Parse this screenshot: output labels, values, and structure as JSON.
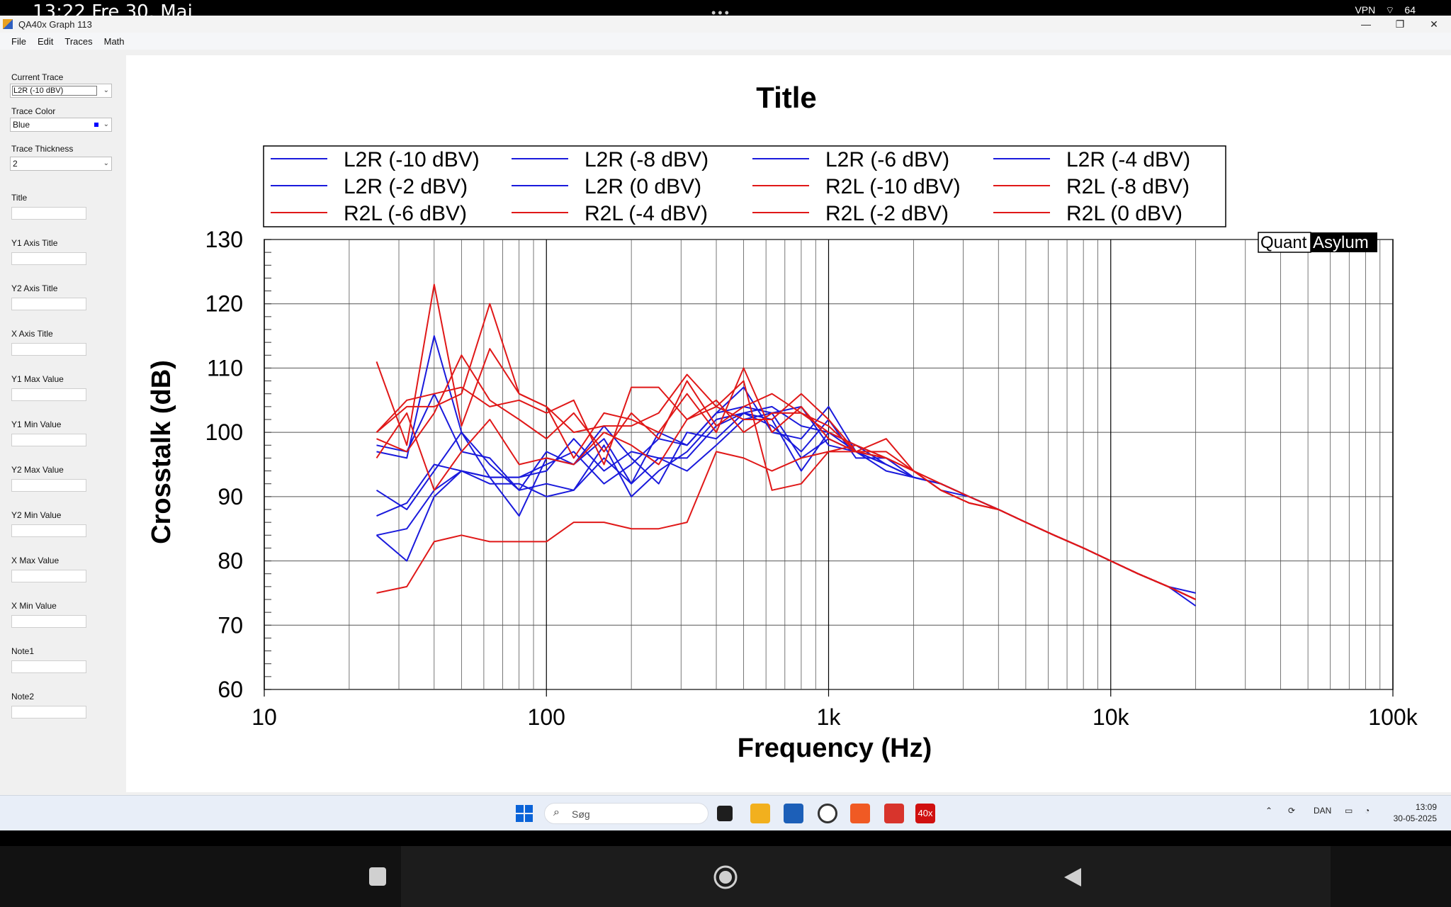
{
  "android": {
    "status_time": "13:22  Fre 30. Maj",
    "status_icons": [
      "VPN",
      "wifi",
      "battery"
    ],
    "battery": "64"
  },
  "window": {
    "title": "QA40x Graph 113",
    "controls": {
      "minimize": "—",
      "maximize": "❐",
      "close": "✕"
    }
  },
  "menu": [
    "File",
    "Edit",
    "Traces",
    "Math"
  ],
  "panel": {
    "current_trace_label": "Current Trace",
    "current_trace_value": "L2R (-10 dBV)",
    "trace_color_label": "Trace Color",
    "trace_color_value": "Blue",
    "trace_thickness_label": "Trace Thickness",
    "trace_thickness_value": "2",
    "fields": [
      {
        "label": "Title",
        "value": ""
      },
      {
        "label": "Y1 Axis Title",
        "value": ""
      },
      {
        "label": "Y2 Axis Title",
        "value": ""
      },
      {
        "label": "X Axis Title",
        "value": ""
      },
      {
        "label": "Y1 Max Value",
        "value": ""
      },
      {
        "label": "Y1 Min Value",
        "value": ""
      },
      {
        "label": "Y2 Max Value",
        "value": ""
      },
      {
        "label": "Y2 Min Value",
        "value": ""
      },
      {
        "label": "X Max Value",
        "value": ""
      },
      {
        "label": "X Min Value",
        "value": ""
      },
      {
        "label": "Note1",
        "value": ""
      },
      {
        "label": "Note2",
        "value": ""
      }
    ]
  },
  "chart_data": {
    "type": "line",
    "title": "Title",
    "xlabel": "Frequency (Hz)",
    "ylabel": "Crosstalk (dB)",
    "x_scale": "log",
    "xlim": [
      10,
      100000
    ],
    "ylim": [
      60,
      130
    ],
    "x_ticks": [
      {
        "value": 10,
        "label": "10"
      },
      {
        "value": 100,
        "label": "100"
      },
      {
        "value": 1000,
        "label": "1k"
      },
      {
        "value": 10000,
        "label": "10k"
      },
      {
        "value": 100000,
        "label": "100k"
      }
    ],
    "y_ticks": [
      130,
      120,
      110,
      100,
      90,
      80,
      70,
      60
    ],
    "grid": true,
    "legend_position": "top",
    "watermark": {
      "part1": "Quant",
      "part2": "Asylum"
    },
    "colors": {
      "L2R": "#1a1adc",
      "R2L": "#e01818"
    },
    "x": [
      25,
      32,
      40,
      50,
      63,
      80,
      100,
      125,
      160,
      200,
      250,
      315,
      400,
      500,
      630,
      800,
      1000,
      1250,
      1600,
      2000,
      2500,
      3150,
      4000,
      5000,
      6300,
      8000,
      10000,
      12500,
      16000,
      20000
    ],
    "series": [
      {
        "name": "L2R (-10 dBV)",
        "group": "L2R",
        "values": [
          91,
          88,
          94,
          100,
          93,
          93,
          95,
          97,
          92,
          95,
          99,
          98,
          103,
          107,
          100,
          99,
          104,
          97,
          94,
          93,
          92,
          90,
          88,
          86,
          84,
          82,
          80,
          78,
          76,
          75
        ]
      },
      {
        "name": "L2R (-8 dBV)",
        "group": "L2R",
        "values": [
          87,
          89,
          95,
          94,
          93,
          87,
          96,
          95,
          101,
          96,
          92,
          100,
          99,
          103,
          101,
          97,
          102,
          96,
          96,
          94,
          91,
          90,
          88,
          86,
          84,
          82,
          80,
          78,
          76,
          74
        ]
      },
      {
        "name": "L2R (-6 dBV)",
        "group": "L2R",
        "values": [
          97,
          96,
          115,
          100,
          95,
          91,
          92,
          91,
          98,
          90,
          94,
          97,
          102,
          103,
          104,
          101,
          100,
          98,
          95,
          93,
          92,
          90,
          88,
          86,
          84,
          82,
          80,
          78,
          76,
          74
        ]
      },
      {
        "name": "L2R (-4 dBV)",
        "group": "L2R",
        "values": [
          84,
          85,
          91,
          94,
          93,
          93,
          94,
          99,
          94,
          97,
          96,
          96,
          101,
          103,
          102,
          94,
          100,
          97,
          96,
          93,
          92,
          90,
          88,
          86,
          84,
          82,
          80,
          78,
          76,
          74
        ]
      },
      {
        "name": "L2R (-2 dBV)",
        "group": "L2R",
        "values": [
          84,
          80,
          90,
          94,
          92,
          92,
          90,
          91,
          96,
          92,
          96,
          94,
          98,
          102,
          103,
          96,
          99,
          97,
          95,
          93,
          92,
          90,
          88,
          86,
          84,
          82,
          80,
          78,
          76,
          73
        ]
      },
      {
        "name": "L2R (0 dBV)",
        "group": "L2R",
        "values": [
          98,
          97,
          106,
          97,
          96,
          91,
          97,
          95,
          99,
          92,
          100,
          98,
          103,
          104,
          103,
          104,
          98,
          97,
          95,
          93,
          92,
          90,
          88,
          86,
          84,
          82,
          80,
          78,
          76,
          74
        ]
      },
      {
        "name": "R2L (-10 dBV)",
        "group": "R2L",
        "values": [
          75,
          76,
          83,
          84,
          83,
          83,
          83,
          86,
          86,
          85,
          85,
          86,
          97,
          96,
          94,
          96,
          97,
          98,
          96,
          94,
          92,
          90,
          88,
          86,
          84,
          82,
          80,
          78,
          76,
          74
        ]
      },
      {
        "name": "R2L (-8 dBV)",
        "group": "R2L",
        "values": [
          96,
          103,
          91,
          97,
          102,
          95,
          96,
          95,
          100,
          98,
          95,
          102,
          104,
          108,
          91,
          92,
          97,
          97,
          96,
          94,
          92,
          90,
          88,
          86,
          84,
          82,
          80,
          78,
          76,
          74
        ]
      },
      {
        "name": "R2L (-6 dBV)",
        "group": "R2L",
        "values": [
          111,
          98,
          123,
          101,
          113,
          106,
          104,
          96,
          103,
          102,
          100,
          106,
          100,
          110,
          100,
          104,
          99,
          97,
          97,
          94,
          91,
          89,
          88,
          86,
          84,
          82,
          80,
          78,
          76,
          74
        ]
      },
      {
        "name": "R2L (-4 dBV)",
        "group": "R2L",
        "values": [
          99,
          97,
          103,
          112,
          105,
          102,
          99,
          103,
          97,
          103,
          99,
          108,
          101,
          104,
          106,
          103,
          101,
          97,
          96,
          94,
          91,
          89,
          88,
          86,
          84,
          82,
          80,
          78,
          76,
          74
        ]
      },
      {
        "name": "R2L (-2 dBV)",
        "group": "R2L",
        "values": [
          100,
          104,
          104,
          106,
          120,
          106,
          104,
          100,
          101,
          101,
          103,
          109,
          104,
          102,
          102,
          106,
          102,
          97,
          99,
          94,
          91,
          89,
          88,
          86,
          84,
          82,
          80,
          78,
          76,
          74
        ]
      },
      {
        "name": "R2L (0 dBV)",
        "group": "R2L",
        "values": [
          100,
          105,
          106,
          107,
          104,
          105,
          103,
          105,
          95,
          107,
          107,
          102,
          105,
          100,
          103,
          103,
          100,
          98,
          96,
          94,
          91,
          89,
          88,
          86,
          84,
          82,
          80,
          78,
          76,
          74
        ]
      }
    ]
  },
  "taskbar": {
    "search_placeholder": "Søg",
    "tray_lang": "DAN",
    "clock_time": "13:09",
    "clock_date": "30-05-2025",
    "active_app_label": "40x"
  }
}
